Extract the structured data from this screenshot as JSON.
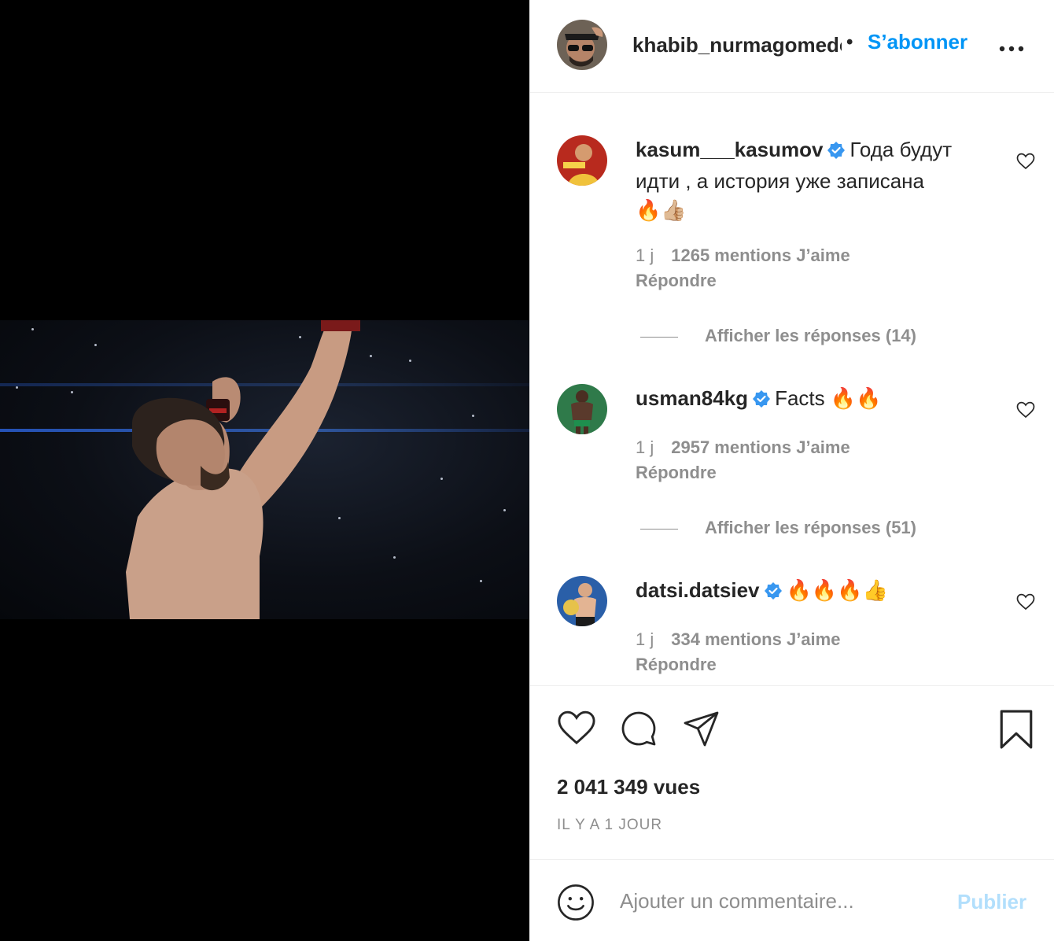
{
  "header": {
    "username": "khabib_nurmagomedov",
    "separator": "•",
    "follow_label": "S’abonner",
    "more_label": "•••"
  },
  "peek_text": "Afficher les réponses (…)",
  "comments": [
    {
      "username": "kasum___kasumov",
      "text": "Года будут идти , а история уже записана",
      "emoji": "🔥👍🏼",
      "time": "1 j",
      "likes": "1265 mentions J’aime",
      "reply_label": "Répondre",
      "show_replies": "Afficher les réponses (14)"
    },
    {
      "username": "usman84kg",
      "text": "Facts",
      "emoji": "🔥🔥",
      "time": "1 j",
      "likes": "2957 mentions J’aime",
      "reply_label": "Répondre",
      "show_replies": "Afficher les réponses (51)"
    },
    {
      "username": "datsi.datsiev",
      "text": "",
      "emoji": "🔥🔥🔥👍",
      "time": "1 j",
      "likes": "334 mentions J’aime",
      "reply_label": "Répondre"
    }
  ],
  "stats": {
    "views": "2 041 349 vues",
    "posted_ago": "IL Y A 1 JOUR"
  },
  "composer": {
    "placeholder": "Ajouter un commentaire...",
    "post_label": "Publier"
  },
  "colors": {
    "accent": "#0095f6",
    "muted": "#8e8e8e",
    "post_disabled": "#b2dffc",
    "verified": "#3897f0"
  },
  "icons": [
    "heart-icon",
    "comment-icon",
    "share-icon",
    "bookmark-icon",
    "emoji-icon",
    "verified-badge-icon",
    "more-icon"
  ]
}
